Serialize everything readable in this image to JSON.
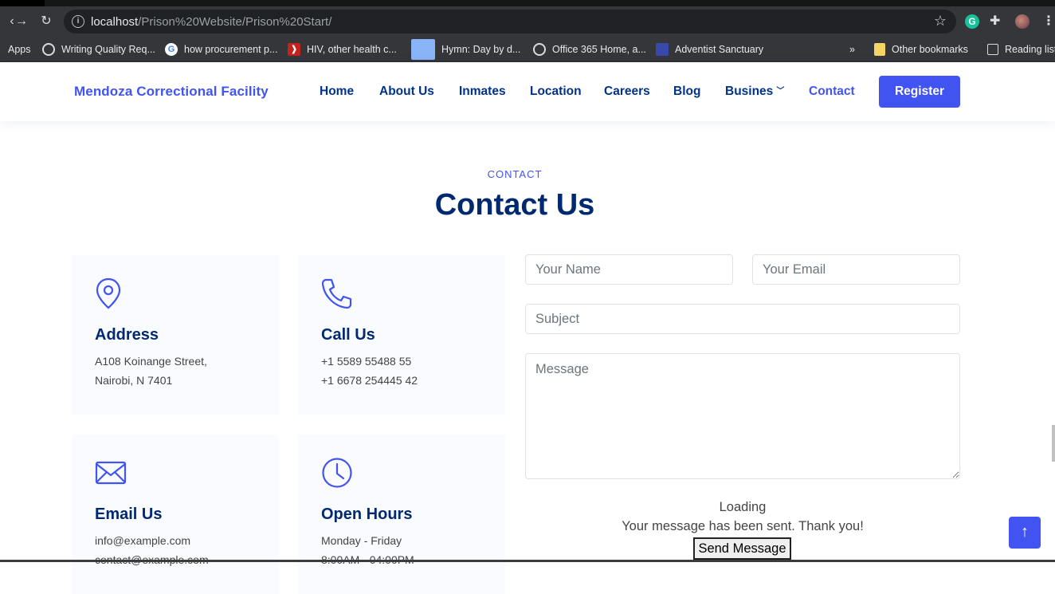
{
  "browser": {
    "url_host": "localhost",
    "url_path": "/Prison%20Website/Prison%20Start/",
    "bookmarks": [
      {
        "label": "Apps",
        "icon": "apps-grid-icon"
      },
      {
        "label": "Writing Quality Req...",
        "icon": "globe-icon"
      },
      {
        "label": "how procurement p...",
        "icon": "google-icon"
      },
      {
        "label": "HIV, other health c...",
        "icon": "hiv-site-icon"
      },
      {
        "label": "Hymn: Day by d...",
        "icon": "hymn-thumbnail-icon"
      },
      {
        "label": "Office 365 Home, a...",
        "icon": "globe-icon"
      },
      {
        "label": "Adventist Sanctuary",
        "icon": "adventist-site-icon"
      }
    ],
    "bookmarks_overflow": "»",
    "other_bookmarks": "Other bookmarks",
    "reading_list": "Reading list"
  },
  "header": {
    "logo": "Mendoza Correctional Facility",
    "nav": [
      {
        "label": "Home",
        "active": false
      },
      {
        "label": "About Us",
        "active": false
      },
      {
        "label": "Inmates",
        "active": false
      },
      {
        "label": "Location",
        "active": false
      },
      {
        "label": "Careers",
        "active": false
      },
      {
        "label": "Blog",
        "active": false
      },
      {
        "label": "Busines",
        "active": false,
        "dropdown": true
      },
      {
        "label": "Contact",
        "active": true
      }
    ],
    "register": "Register"
  },
  "contact": {
    "eyebrow": "CONTACT",
    "title": "Contact Us",
    "boxes": [
      {
        "icon": "map-pin-icon",
        "title": "Address",
        "lines": [
          "A108 Koinange Street,",
          "Nairobi, N 7401"
        ]
      },
      {
        "icon": "phone-icon",
        "title": "Call Us",
        "lines": [
          "+1 5589 55488 55",
          "+1 6678 254445 42"
        ]
      },
      {
        "icon": "envelope-icon",
        "title": "Email Us",
        "lines": [
          "info@example.com",
          "contact@example.com"
        ]
      },
      {
        "icon": "clock-icon",
        "title": "Open Hours",
        "lines": [
          "Monday - Friday",
          "8:00AM - 04:00PM"
        ]
      }
    ],
    "form": {
      "name_placeholder": "Your Name",
      "email_placeholder": "Your Email",
      "subject_placeholder": "Subject",
      "message_placeholder": "Message",
      "loading": "Loading",
      "sent_message": "Your message has been sent. Thank you!",
      "send_button": "Send Message"
    }
  },
  "back_to_top": "↑",
  "colors": {
    "accent": "#4154f1",
    "heading": "#012970",
    "nav": "#013289"
  }
}
